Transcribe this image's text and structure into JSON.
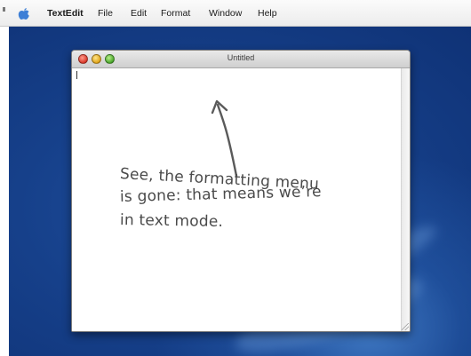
{
  "menubar": {
    "app_name": "TextEdit",
    "items": [
      "File",
      "Edit",
      "Format",
      "Window",
      "Help"
    ]
  },
  "window": {
    "title": "Untitled"
  },
  "annotation": {
    "lines": [
      "See, the formatting menu",
      "is gone: that means we’re",
      "in text mode."
    ]
  },
  "colors": {
    "desktop_blue": "#16408a",
    "menubar_bg": "#f4f4f4",
    "annotation_ink": "#4a4a4a",
    "close_button": "#d9382a",
    "minimize_button": "#e0a419",
    "zoom_button": "#4aa62c"
  },
  "icons": [
    "apple-menu-icon",
    "close-button-icon",
    "minimize-button-icon",
    "zoom-button-icon",
    "resize-grip-icon"
  ]
}
